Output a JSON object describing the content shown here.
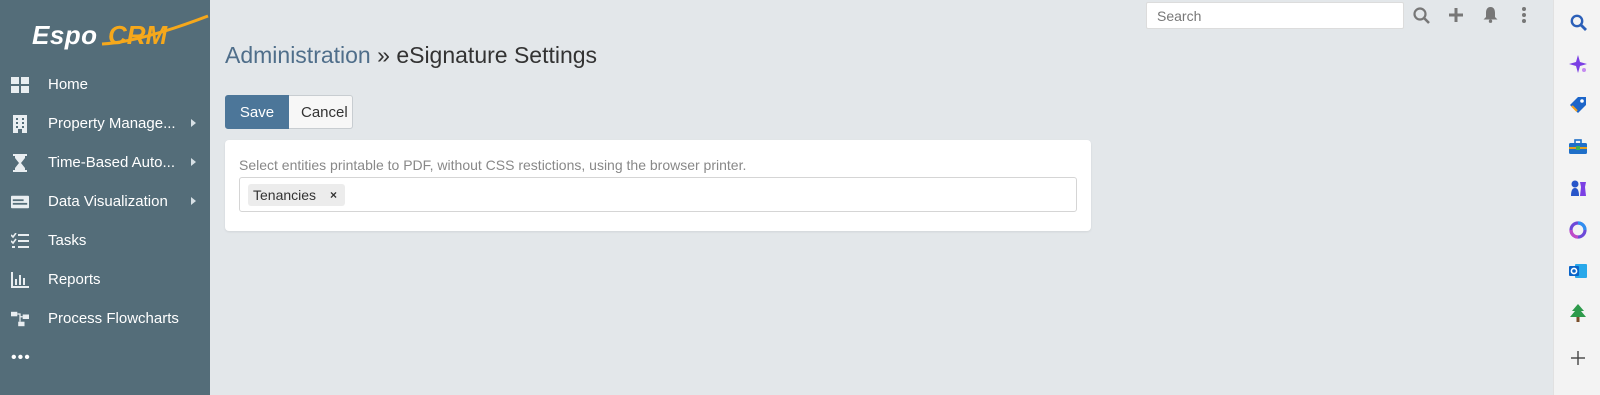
{
  "app": {
    "logo_text_left": "Espo",
    "logo_text_right": "CRM"
  },
  "sidebar": {
    "items": [
      {
        "label": "Home",
        "icon": "home-grid-icon",
        "has_submenu": false
      },
      {
        "label": "Property Manage...",
        "icon": "building-icon",
        "has_submenu": true
      },
      {
        "label": "Time-Based Auto...",
        "icon": "hourglass-icon",
        "has_submenu": true
      },
      {
        "label": "Data Visualization",
        "icon": "card-icon",
        "has_submenu": true
      },
      {
        "label": "Tasks",
        "icon": "task-list-icon",
        "has_submenu": false
      },
      {
        "label": "Reports",
        "icon": "bar-chart-icon",
        "has_submenu": false
      },
      {
        "label": "Process Flowcharts",
        "icon": "flowchart-icon",
        "has_submenu": false
      }
    ],
    "more": "•••"
  },
  "header": {
    "search_placeholder": "Search"
  },
  "page": {
    "breadcrumb": "Administration",
    "separator": " » ",
    "title": "eSignature Settings"
  },
  "buttons": {
    "save": "Save",
    "cancel": "Cancel"
  },
  "panel": {
    "description": "Select entities printable to PDF, without CSS restictions, using the browser printer.",
    "tags": [
      {
        "label": "Tenancies",
        "remove": "×"
      }
    ]
  },
  "colors": {
    "sidebar_bg": "#546d79",
    "accent": "#4c7699",
    "logo_orange": "#f6a81b",
    "page_bg": "#e3e7ea"
  },
  "right_bar": {
    "icons": [
      "search-icon",
      "copilot-sparkle-icon",
      "tag-icon",
      "briefcase-icon",
      "chess-icon",
      "office-icon",
      "outlook-icon",
      "tree-icon",
      "plus-icon"
    ]
  }
}
